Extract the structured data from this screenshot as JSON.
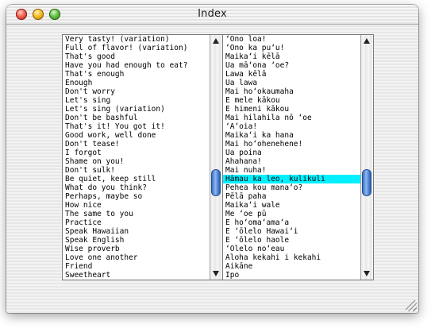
{
  "window": {
    "title": "Index"
  },
  "english_list": [
    "Very tasty! (variation)",
    "Full of flavor! (variation)",
    "That's good",
    "Have you had enough to eat?",
    "That's enough",
    "Enough",
    "Don't worry",
    "Let's sing",
    "Let's sing (variation)",
    "Don't be bashful",
    "That's it! You got it!",
    "Good work, well done",
    "Don't tease!",
    "I forgot",
    "Shame on you!",
    "Don't sulk!",
    "Be quiet, keep still",
    "What do you think?",
    "Perhaps, maybe so",
    "How nice",
    "The same to you",
    "Practice",
    "Speak Hawaiian",
    "Speak English",
    "Wise proverb",
    "Love one another",
    "Friend",
    "Sweetheart"
  ],
  "hawaiian_list": [
    "‘Ono loa!",
    "‘Ono ka pu‘u!",
    "Maika‘i kēlā",
    "Ua mā‘ona ‘oe?",
    "Lawa kēlā",
    "Ua lawa",
    "Mai ho‘okaumaha",
    "E mele kākou",
    "E himeni kākou",
    "Mai hilahila nō ‘oe",
    "‘A‘oia!",
    "Maika‘i ka hana",
    "Mai ho‘ohenehene!",
    "Ua poina",
    "Ahahana!",
    "Mai nuha!",
    "Hāmau ka leo, kulikuli",
    "Pehea kou mana‘o?",
    "Pēlā paha",
    "Maika‘i wale",
    "Me ‘oe pū",
    "E ho‘oma‘ama‘a",
    "E ‘ōlelo Hawai‘i",
    "E ‘ōlelo haole",
    "‘Olelo no‘eau",
    "Aloha kekahi i kekahi",
    "Aikāne",
    "Ipo"
  ],
  "selected_index": 16,
  "selection_color": "#00f0ff",
  "icons": {
    "close": "close-button",
    "minimize": "minimize-button",
    "zoom": "zoom-button",
    "scroll_up": "up-arrow-icon",
    "scroll_down": "down-arrow-icon",
    "resize": "resize-grip-icon"
  }
}
